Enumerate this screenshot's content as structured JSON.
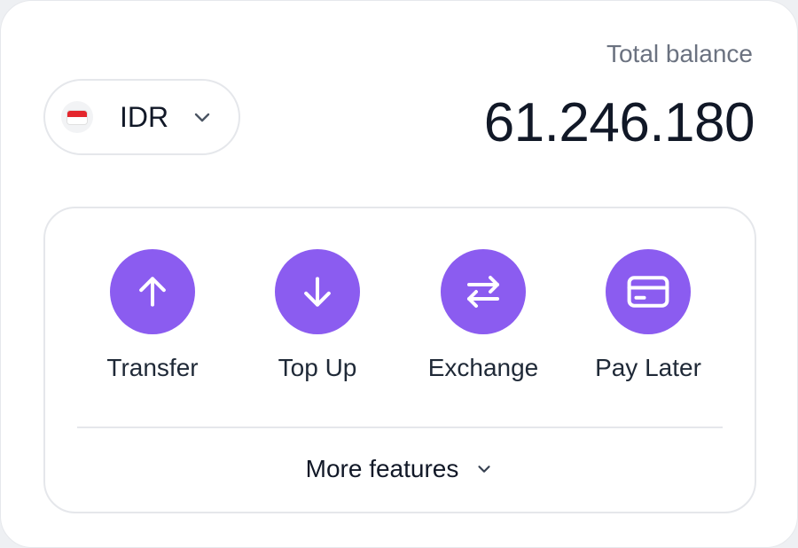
{
  "currency": {
    "code": "IDR",
    "flag_icon": "indonesia-flag-icon",
    "chevron_icon": "chevron-down-icon"
  },
  "balance": {
    "label": "Total balance",
    "value": "61.246.180"
  },
  "actions": [
    {
      "label": "Transfer",
      "icon": "arrow-up-icon"
    },
    {
      "label": "Top Up",
      "icon": "arrow-down-icon"
    },
    {
      "label": "Exchange",
      "icon": "swap-arrows-icon"
    },
    {
      "label": "Pay Later",
      "icon": "credit-card-icon"
    }
  ],
  "more": {
    "label": "More features",
    "icon": "chevron-down-icon"
  },
  "colors": {
    "accent": "#8b5cf0",
    "text_primary": "#111827",
    "text_secondary": "#6b7280",
    "border": "#e5e7eb",
    "flag_red": "#e4262d"
  }
}
